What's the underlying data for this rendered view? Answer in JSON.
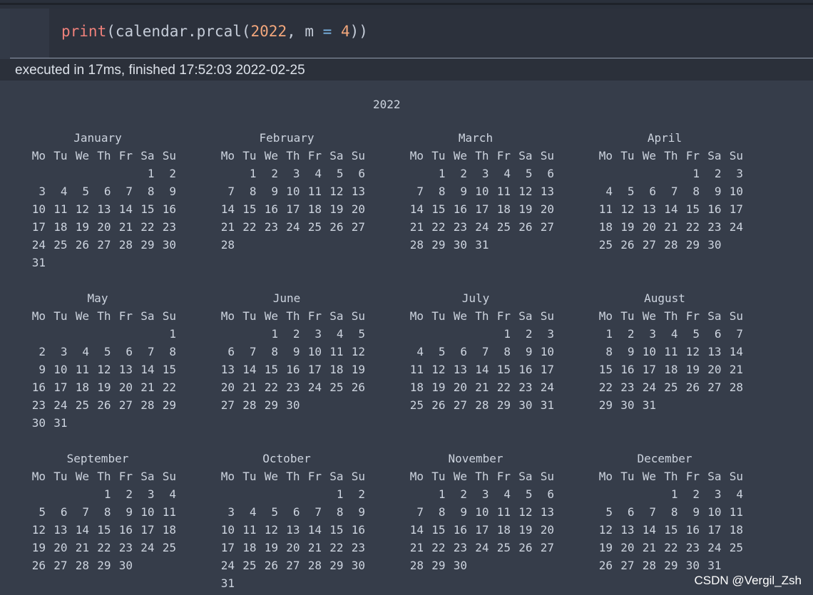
{
  "code_cell": {
    "tokens": [
      {
        "text": "print",
        "kind": "builtin"
      },
      {
        "text": "(calendar.prcal(",
        "kind": "plain"
      },
      {
        "text": "2022",
        "kind": "number"
      },
      {
        "text": ", m ",
        "kind": "plain"
      },
      {
        "text": "=",
        "kind": "operator"
      },
      {
        "text": " ",
        "kind": "plain"
      },
      {
        "text": "4",
        "kind": "number"
      },
      {
        "text": "))",
        "kind": "plain"
      }
    ]
  },
  "execution_status": "executed in 17ms, finished 17:52:03 2022-02-25",
  "output": {
    "year": "2022",
    "weekdays": [
      "Mo",
      "Tu",
      "We",
      "Th",
      "Fr",
      "Sa",
      "Su"
    ],
    "months": [
      {
        "name": "January",
        "first_weekday": 5,
        "days": 31
      },
      {
        "name": "February",
        "first_weekday": 1,
        "days": 28
      },
      {
        "name": "March",
        "first_weekday": 1,
        "days": 31
      },
      {
        "name": "April",
        "first_weekday": 4,
        "days": 30
      },
      {
        "name": "May",
        "first_weekday": 6,
        "days": 31
      },
      {
        "name": "June",
        "first_weekday": 2,
        "days": 30
      },
      {
        "name": "July",
        "first_weekday": 4,
        "days": 31
      },
      {
        "name": "August",
        "first_weekday": 0,
        "days": 31
      },
      {
        "name": "September",
        "first_weekday": 3,
        "days": 30
      },
      {
        "name": "October",
        "first_weekday": 5,
        "days": 31
      },
      {
        "name": "November",
        "first_weekday": 1,
        "days": 30
      },
      {
        "name": "December",
        "first_weekday": 3,
        "days": 31
      }
    ]
  },
  "watermark": "CSDN @Vergil_Zsh",
  "colors": {
    "builtin": "#f0817b",
    "number": "#f3a77c",
    "operator": "#7cb8e8",
    "output_text": "#cdd4df"
  }
}
